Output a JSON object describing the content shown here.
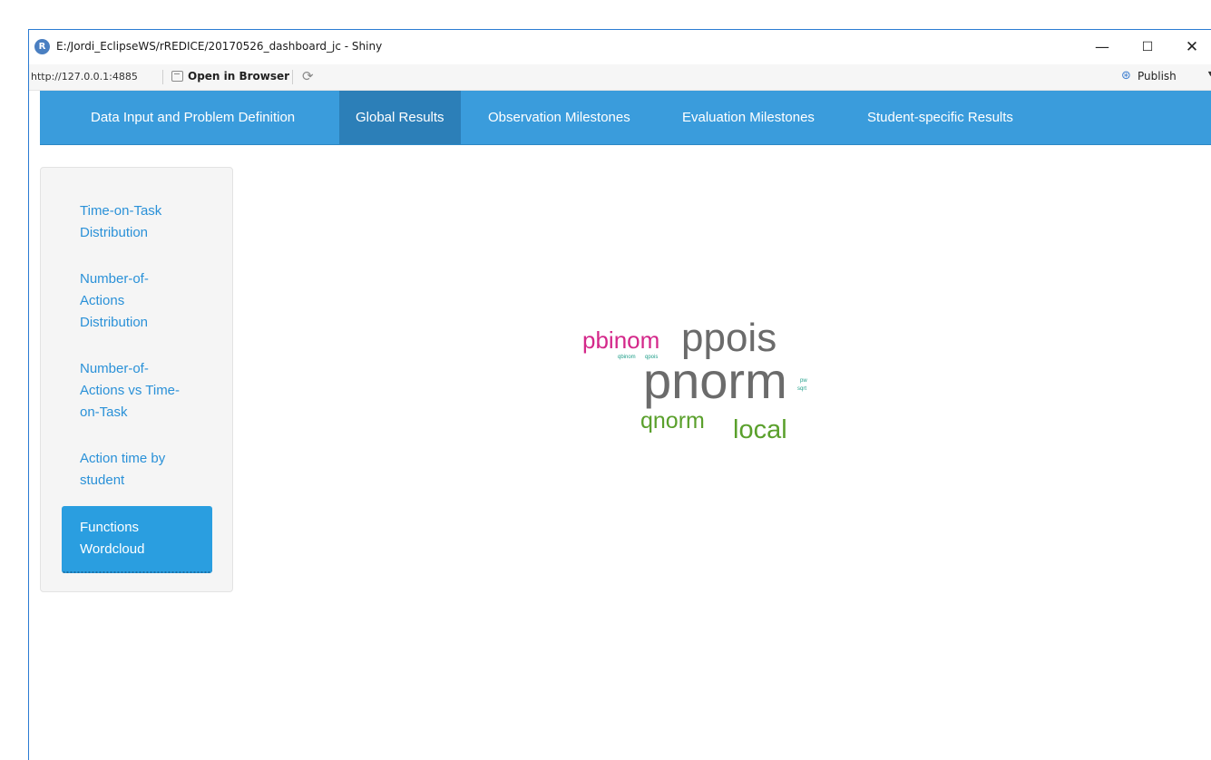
{
  "window": {
    "title": "E:/Jordi_EclipseWS/rREDICE/20170526_dashboard_jc - Shiny",
    "app_icon_glyph": "R",
    "minimize_glyph": "—",
    "maximize_glyph": "☐",
    "close_glyph": "✕"
  },
  "toolbar": {
    "url": "http://127.0.0.1:4885",
    "open_in_browser": "Open in Browser",
    "refresh_glyph": "⟳",
    "publish": "Publish",
    "publish_icon_glyph": "⊛",
    "publish_chevron": "▼"
  },
  "nav": {
    "tabs": [
      {
        "label": "Data Input and Problem Definition",
        "active": false
      },
      {
        "label": "Global Results",
        "active": true
      },
      {
        "label": "Observation Milestones",
        "active": false
      },
      {
        "label": "Evaluation Milestones",
        "active": false
      },
      {
        "label": "Student-specific Results",
        "active": false
      }
    ],
    "bar_color": "#3a9cdc",
    "active_color": "#2c7fb8"
  },
  "sidebar": {
    "items": [
      {
        "lines": [
          "Time-on-Task",
          "Distribution"
        ],
        "active": false
      },
      {
        "lines": [
          "Number-of-",
          "Actions",
          "Distribution"
        ],
        "active": false
      },
      {
        "lines": [
          "Number-of-",
          "Actions vs Time-",
          "on-Task"
        ],
        "active": false
      },
      {
        "lines": [
          "Action time by",
          "student"
        ],
        "active": false
      },
      {
        "lines": [
          "Functions",
          "Wordcloud"
        ],
        "active": true
      }
    ]
  },
  "wordcloud": {
    "words": [
      {
        "text": "ppois",
        "color": "#6b6b6b"
      },
      {
        "text": "pnorm",
        "color": "#6b6b6b"
      },
      {
        "text": "pbinom",
        "color": "#d4288a"
      },
      {
        "text": "qnorm",
        "color": "#5aa02c"
      },
      {
        "text": "local",
        "color": "#5aa02c"
      },
      {
        "text": "qbinom",
        "color": "#1f9e89"
      },
      {
        "text": "qpois",
        "color": "#1f9e89"
      },
      {
        "text": "pw",
        "color": "#1f9e89"
      },
      {
        "text": "sqrt",
        "color": "#1f9e89"
      }
    ]
  }
}
